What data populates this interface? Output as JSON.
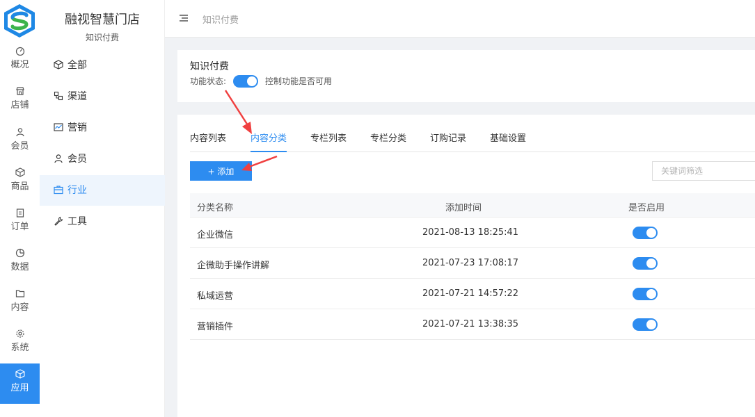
{
  "rail": [
    {
      "label": "概况",
      "icon": "gauge-icon"
    },
    {
      "label": "店铺",
      "icon": "store-icon"
    },
    {
      "label": "会员",
      "icon": "user-icon"
    },
    {
      "label": "商品",
      "icon": "box-icon"
    },
    {
      "label": "订单",
      "icon": "clipboard-icon"
    },
    {
      "label": "数据",
      "icon": "pie-icon"
    },
    {
      "label": "内容",
      "icon": "folder-icon"
    },
    {
      "label": "系统",
      "icon": "gear-icon"
    },
    {
      "label": "应用",
      "icon": "cube-icon"
    }
  ],
  "store": {
    "name": "融视智慧门店",
    "subtitle": "知识付费"
  },
  "subnav": [
    {
      "label": "全部",
      "icon": "cube-icon"
    },
    {
      "label": "渠道",
      "icon": "channel-icon"
    },
    {
      "label": "营销",
      "icon": "chart-line-icon"
    },
    {
      "label": "会员",
      "icon": "user-icon"
    },
    {
      "label": "行业",
      "icon": "briefcase-icon"
    },
    {
      "label": "工具",
      "icon": "wrench-icon"
    }
  ],
  "header": {
    "breadcrumb": "知识付费"
  },
  "feature": {
    "title": "知识付费",
    "status_label": "功能状态:",
    "description": "控制功能是否可用",
    "enabled": true
  },
  "tabs": [
    "内容列表",
    "内容分类",
    "专栏列表",
    "专栏分类",
    "订购记录",
    "基础设置"
  ],
  "toolbar": {
    "add_label": "添加",
    "filter_placeholder": "关键词筛选"
  },
  "table": {
    "columns": [
      "分类名称",
      "添加时间",
      "是否启用"
    ],
    "rows": [
      {
        "name": "企业微信",
        "time": "2021-08-13 18:25:41",
        "enabled": true
      },
      {
        "name": "企微助手操作讲解",
        "time": "2021-07-23 17:08:17",
        "enabled": true
      },
      {
        "name": "私域运营",
        "time": "2021-07-21 14:57:22",
        "enabled": true
      },
      {
        "name": "营销插件",
        "time": "2021-07-21 13:38:35",
        "enabled": true
      }
    ]
  },
  "colors": {
    "accent": "#2d8cf0",
    "annotation": "#f04040"
  }
}
